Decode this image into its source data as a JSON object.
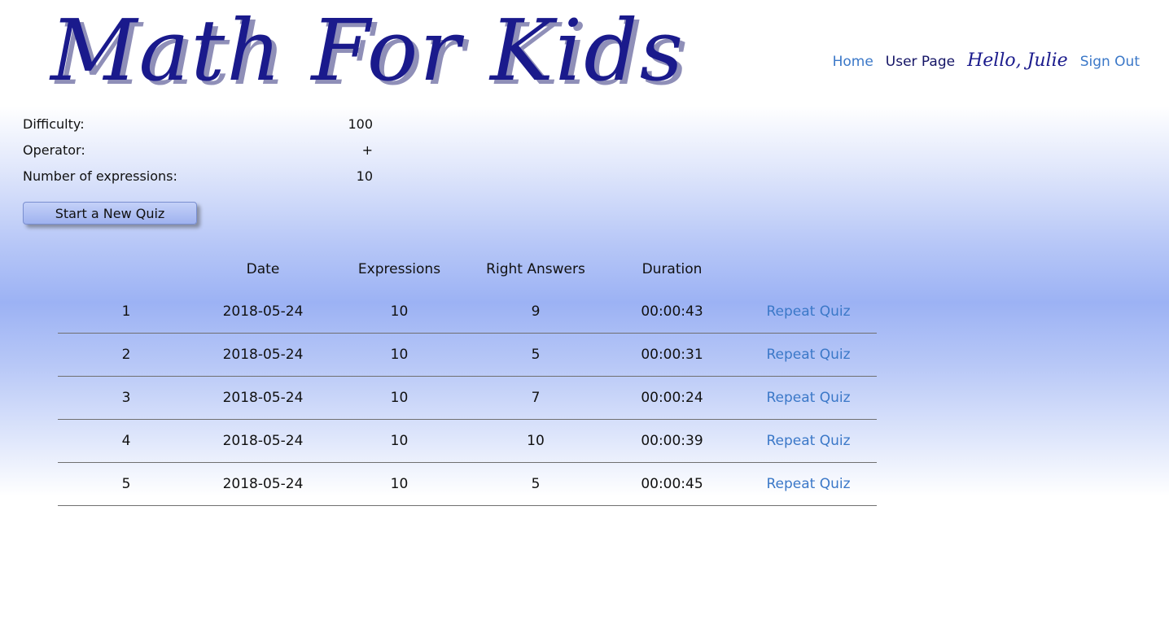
{
  "header": {
    "logo": "Math For Kids",
    "nav": {
      "home": "Home",
      "user_page": "User Page",
      "greeting": "Hello, Julie",
      "sign_out": "Sign Out"
    }
  },
  "settings": {
    "difficulty": {
      "label": "Difficulty:",
      "value": "100"
    },
    "operator": {
      "label": "Operator:",
      "value": "+"
    },
    "expressions": {
      "label": "Number of expressions:",
      "value": "10"
    }
  },
  "start_button": "Start a New Quiz",
  "table": {
    "headers": [
      "",
      "Date",
      "Expressions",
      "Right Answers",
      "Duration",
      ""
    ],
    "rows": [
      {
        "num": "1",
        "date": "2018-05-24",
        "expressions": "10",
        "right": "9",
        "duration": "00:00:43",
        "action": "Repeat Quiz"
      },
      {
        "num": "2",
        "date": "2018-05-24",
        "expressions": "10",
        "right": "5",
        "duration": "00:00:31",
        "action": "Repeat Quiz"
      },
      {
        "num": "3",
        "date": "2018-05-24",
        "expressions": "10",
        "right": "7",
        "duration": "00:00:24",
        "action": "Repeat Quiz"
      },
      {
        "num": "4",
        "date": "2018-05-24",
        "expressions": "10",
        "right": "10",
        "duration": "00:00:39",
        "action": "Repeat Quiz"
      },
      {
        "num": "5",
        "date": "2018-05-24",
        "expressions": "10",
        "right": "5",
        "duration": "00:00:45",
        "action": "Repeat Quiz"
      }
    ]
  },
  "colors": {
    "logo": "#1a1a8c",
    "link": "#3b78c8",
    "gradient_mid": "#9cb2f4"
  }
}
